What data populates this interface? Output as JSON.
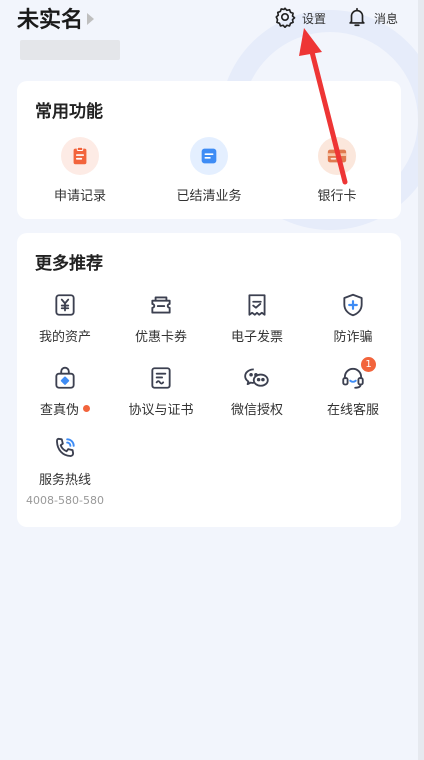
{
  "header": {
    "username": "未实名",
    "settings_label": "设置",
    "messages_label": "消息"
  },
  "common": {
    "title": "常用功能",
    "items": [
      {
        "label": "申请记录",
        "icon": "clipboard-icon"
      },
      {
        "label": "已结清业务",
        "icon": "document-icon"
      },
      {
        "label": "银行卡",
        "icon": "bank-card-icon"
      }
    ]
  },
  "more": {
    "title": "更多推荐",
    "items": [
      {
        "label": "我的资产",
        "icon": "yuan-wallet-icon"
      },
      {
        "label": "优惠卡券",
        "icon": "coupon-icon"
      },
      {
        "label": "电子发票",
        "icon": "invoice-icon"
      },
      {
        "label": "防诈骗",
        "icon": "shield-plus-icon"
      },
      {
        "label": "查真伪",
        "icon": "verify-bag-icon"
      },
      {
        "label": "协议与证书",
        "icon": "agreement-icon"
      },
      {
        "label": "微信授权",
        "icon": "wechat-icon"
      },
      {
        "label": "在线客服",
        "icon": "headset-icon",
        "badge": "1"
      },
      {
        "label": "服务热线",
        "icon": "phone-call-icon",
        "sub": "4008-580-580"
      }
    ]
  },
  "colors": {
    "accent_orange": "#f2643c",
    "accent_blue": "#3e8cf5",
    "icon_dark": "#3c4050",
    "annotation_red": "#ee3535"
  }
}
